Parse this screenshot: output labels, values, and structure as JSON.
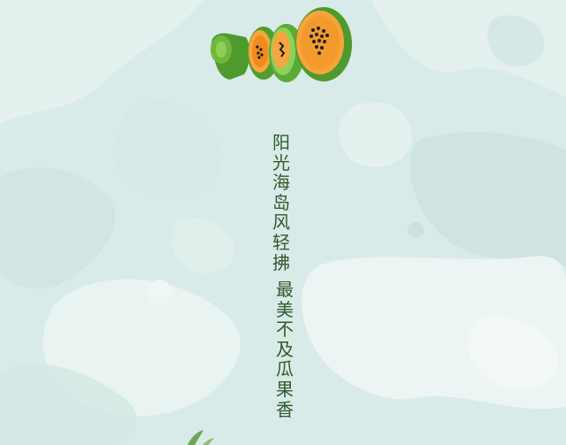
{
  "poster": {
    "background_color": "#dbece9",
    "illustration": "papaya-slices-icon",
    "poem": {
      "line1": [
        "阳",
        "光",
        "海",
        "岛",
        "风",
        "轻",
        "拂"
      ],
      "line2": [
        "最",
        "美",
        "不",
        "及",
        "瓜",
        "果",
        "香"
      ]
    },
    "text_color": "#2f5a2a"
  }
}
